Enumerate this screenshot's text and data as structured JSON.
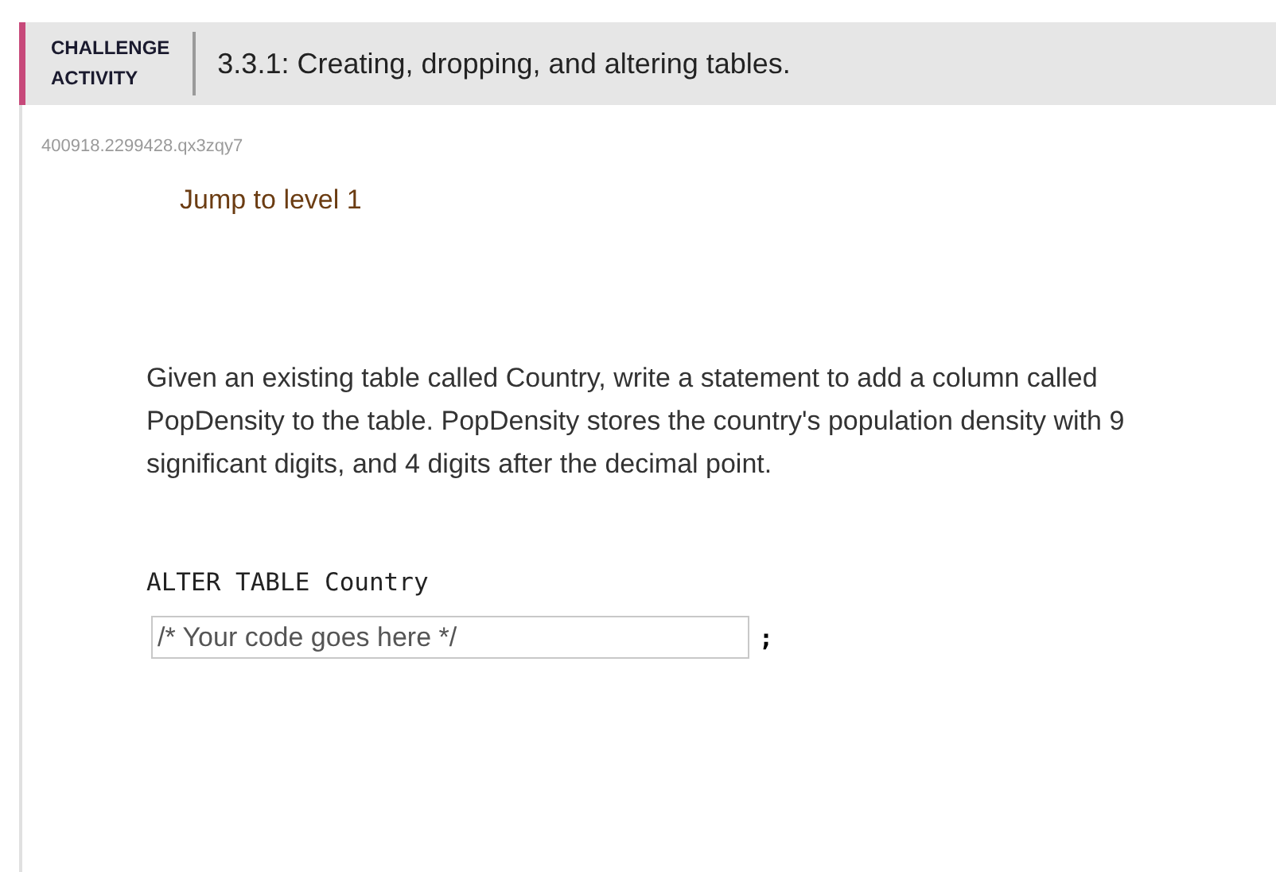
{
  "header": {
    "label_lines": [
      "CHALLENGE",
      "ACTIVITY"
    ],
    "title": "3.3.1: Creating, dropping, and altering tables."
  },
  "activity_id": "400918.2299428.qx3zqy7",
  "jump_link": "Jump to level 1",
  "prompt": "Given an existing table called Country, write a statement to add a column called PopDensity to the table. PopDensity stores the country's population density with 9 significant digits, and 4 digits after the decimal point.",
  "code_line": "ALTER TABLE Country",
  "code_input": {
    "placeholder": "/* Your code goes here */"
  },
  "terminator": ";"
}
